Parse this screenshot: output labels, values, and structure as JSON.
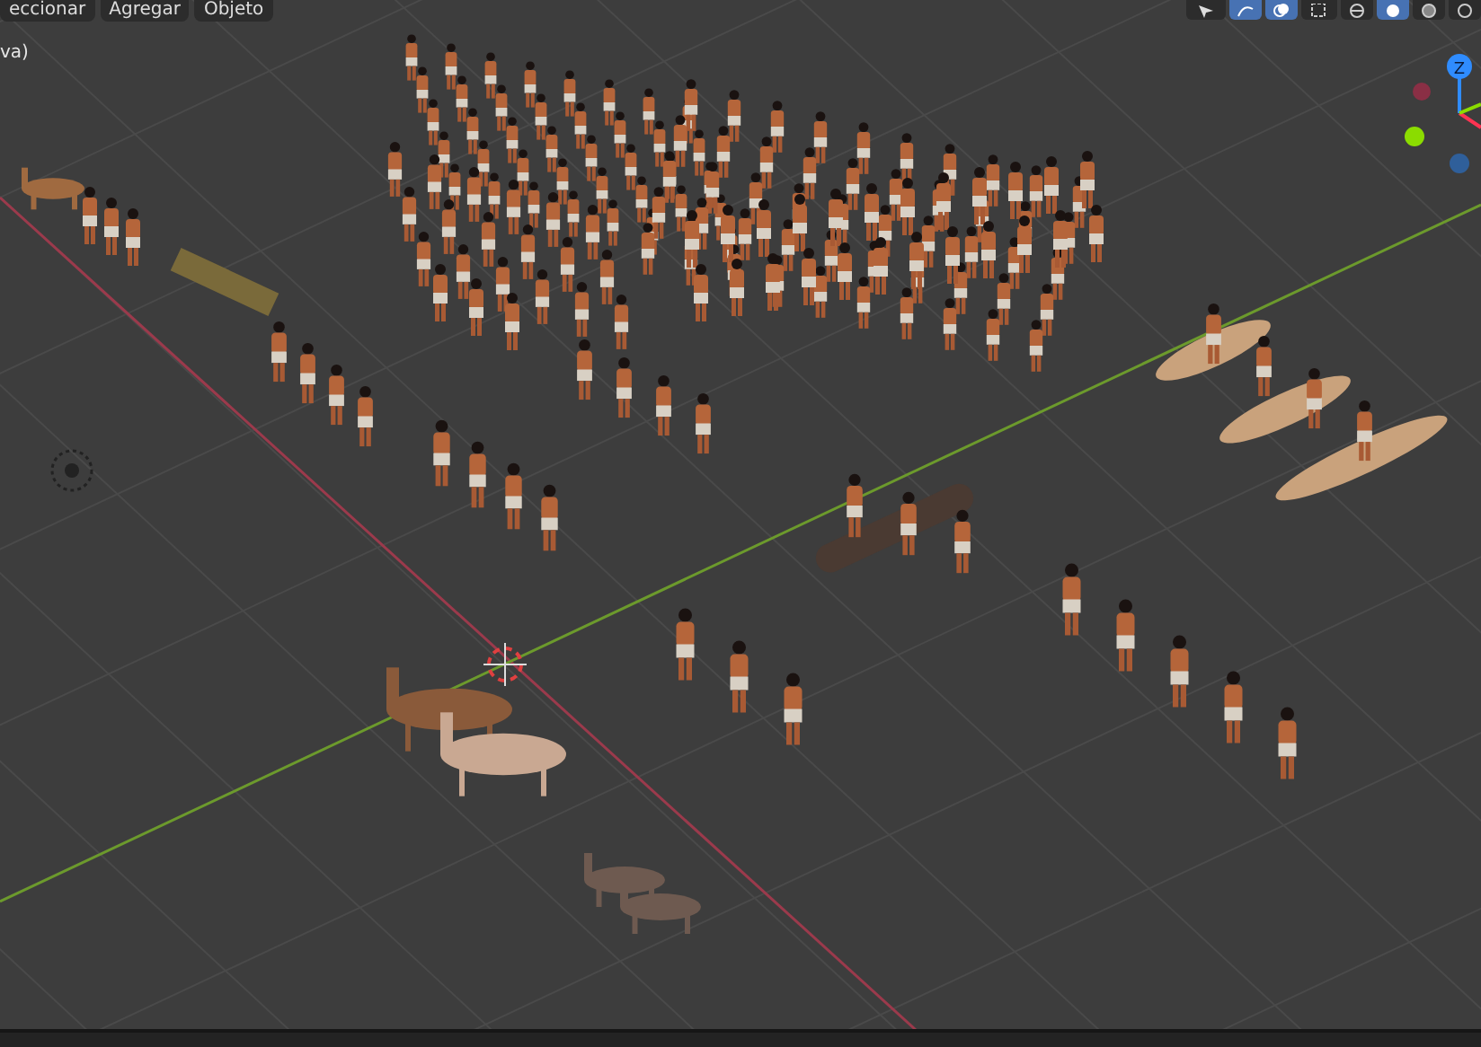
{
  "header": {
    "menus": [
      {
        "label": "eccionar"
      },
      {
        "label": "Agregar"
      },
      {
        "label": "Objeto"
      }
    ],
    "tools": [
      {
        "kind": "cursor",
        "selected": false
      },
      {
        "kind": "gizmo",
        "selected": true
      },
      {
        "kind": "overlay",
        "selected": true
      },
      {
        "kind": "xray",
        "selected": false
      },
      {
        "kind": "wire",
        "selected": false
      },
      {
        "kind": "solid",
        "selected": true
      },
      {
        "kind": "material",
        "selected": false
      },
      {
        "kind": "render",
        "selected": false
      }
    ]
  },
  "viewport": {
    "mode_text": "va)",
    "gizmo": {
      "z_label": "Z"
    }
  }
}
